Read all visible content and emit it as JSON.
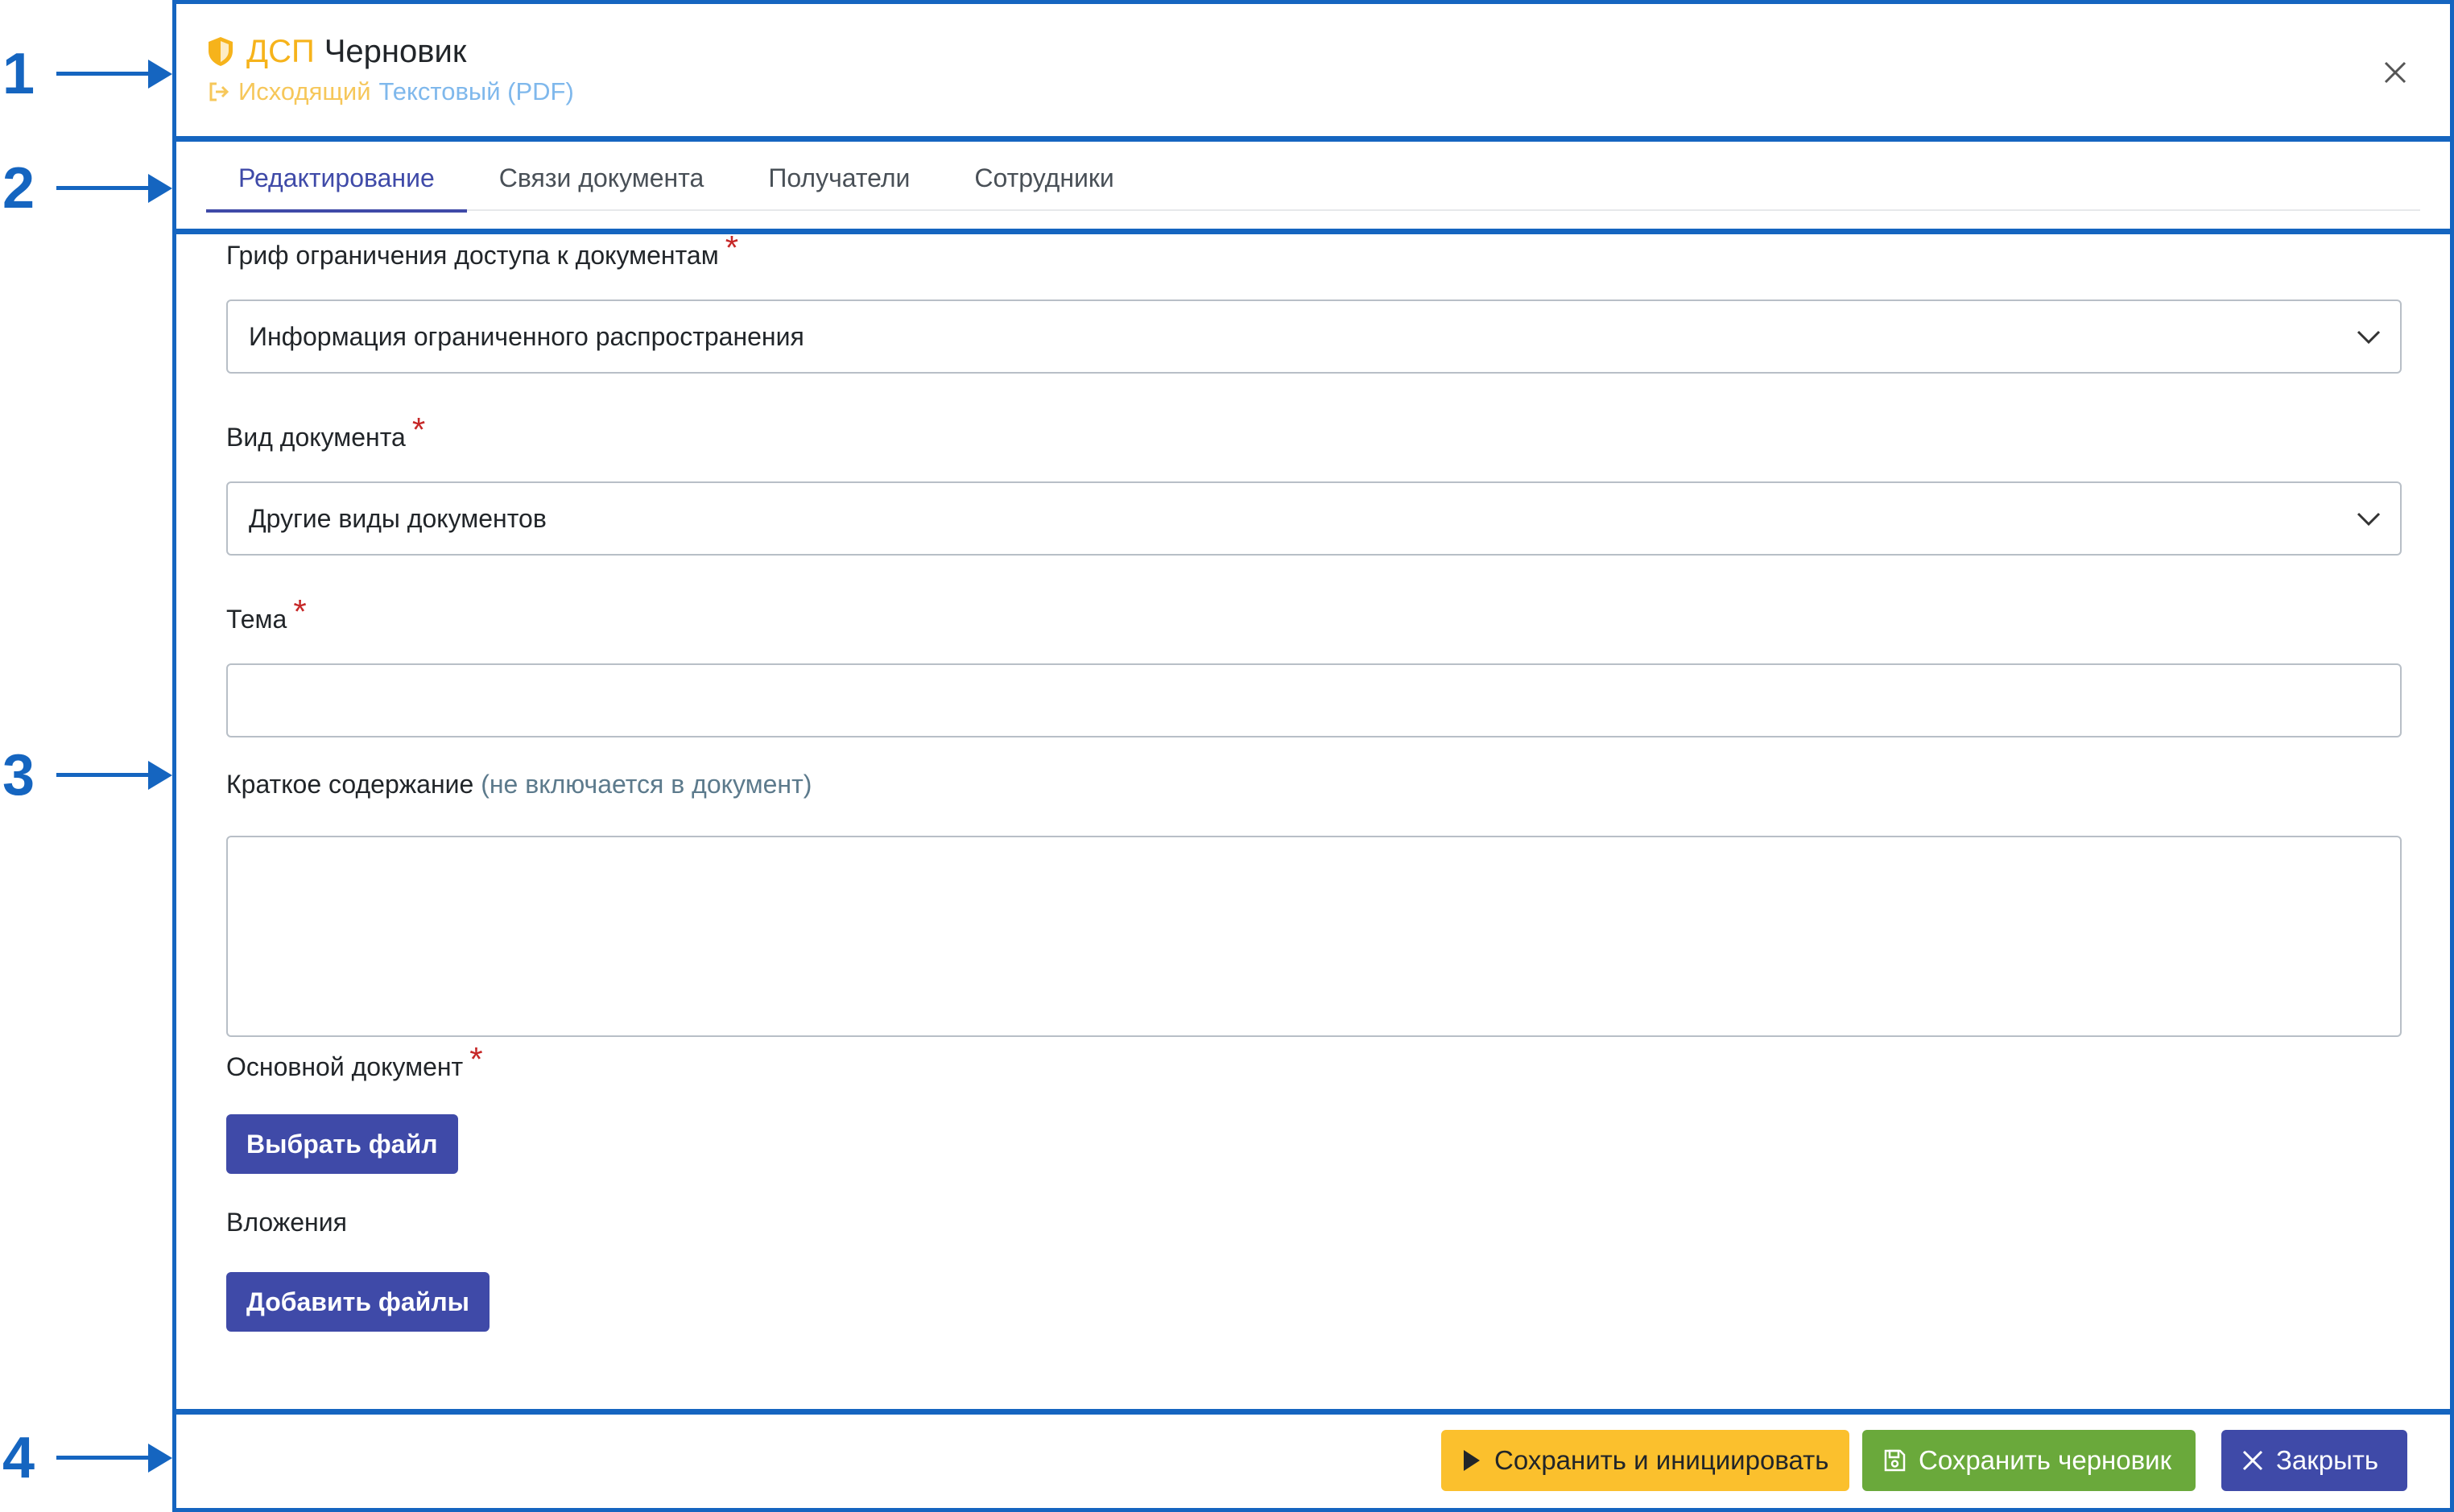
{
  "callouts": [
    "1",
    "2",
    "3",
    "4"
  ],
  "header": {
    "badge": "ДСП",
    "title": "Черновик",
    "direction": "Исходящий",
    "type": "Текстовый (PDF)",
    "badge_color": "#f6b31b",
    "icons": {
      "badge": "shield-icon",
      "direction": "outgoing-icon",
      "close": "close-icon"
    }
  },
  "tabs": [
    {
      "label": "Редактирование",
      "active": true
    },
    {
      "label": "Связи документа",
      "active": false
    },
    {
      "label": "Получатели",
      "active": false
    },
    {
      "label": "Сотрудники",
      "active": false
    }
  ],
  "form": {
    "access_label": "Гриф ограничения доступа к документам",
    "access_value": "Информация ограниченного распространения",
    "doctype_label": "Вид документа",
    "doctype_value": "Другие виды документов",
    "subject_label": "Тема",
    "subject_value": "",
    "summary_label": "Краткое содержание",
    "summary_hint": "(не включается в документ)",
    "summary_value": "",
    "main_doc_label": "Основной документ",
    "main_doc_button": "Выбрать файл",
    "attachments_label": "Вложения",
    "attachments_button": "Добавить файлы",
    "required_mark": "*"
  },
  "footer": {
    "save_init": "Сохранить и инициировать",
    "save_draft": "Сохранить черновик",
    "close": "Закрыть"
  },
  "colors": {
    "accent": "#3f4aa8",
    "warning": "#fbc02d",
    "success": "#6aa93b",
    "callout": "#1565c0"
  }
}
